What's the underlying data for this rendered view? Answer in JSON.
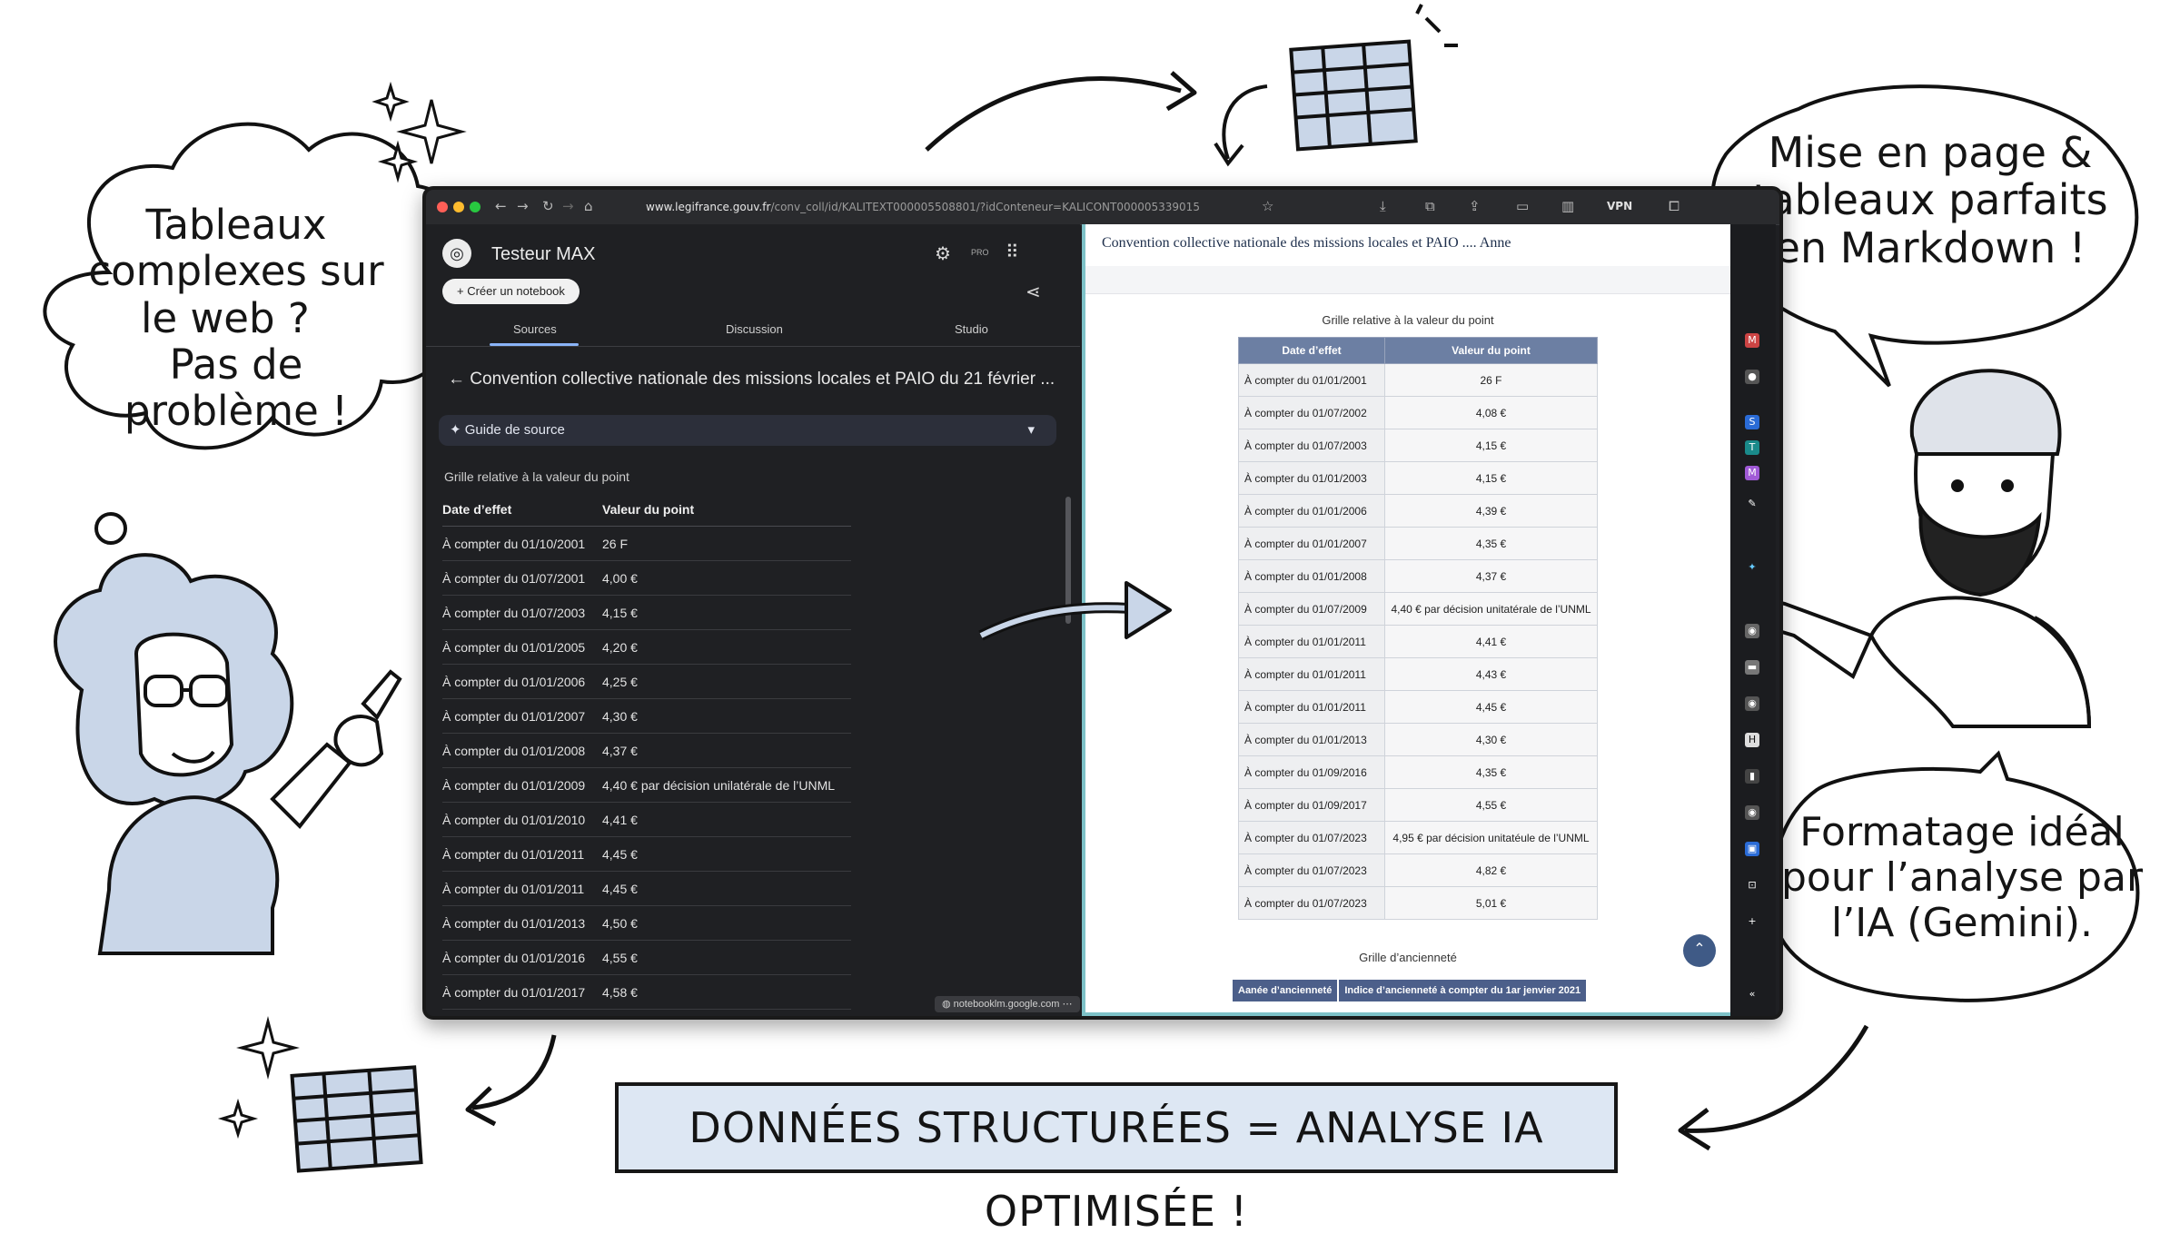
{
  "bubbles": {
    "left_lines": [
      "Tableaux",
      "complexes sur",
      "le web ?",
      "Pas de",
      "problème !"
    ],
    "top_right_lines": [
      "Mise en page &",
      "tableaux parfaits",
      "en Markdown !"
    ],
    "bottom_right_lines": [
      "Formatage idéal",
      "pour l’analyse par",
      "l’IA (Gemini)."
    ]
  },
  "banner_text": "DONNÉES STRUCTURÉES = ANALYSE IA OPTIMISÉE !",
  "browser": {
    "url_domain": "www.legifrance.gouv.fr",
    "url_rest": "/conv_coll/id/KALITEXT000005508801/?idConteneur=KALICONT000005339015",
    "vpn_label": "VPN"
  },
  "notebook": {
    "title": "Testeur MAX",
    "create_button": "Créer un notebook",
    "pro_label": "PRO",
    "tabs": [
      "Sources",
      "Discussion",
      "Studio"
    ],
    "source_title": "Convention collective nationale des missions locales et PAIO du 21 février ...",
    "source_guide": "Guide de source",
    "table_caption": "Grille relative à la valeur du point",
    "table_headers": [
      "Date d’effet",
      "Valeur du point"
    ],
    "rows": [
      [
        "À compter du 01/10/2001",
        "26 F"
      ],
      [
        "À compter du 01/07/2001",
        "4,00 €"
      ],
      [
        "À compter du 01/07/2003",
        "4,15 €"
      ],
      [
        "À compter du 01/01/2005",
        "4,20 €"
      ],
      [
        "À compter du 01/01/2006",
        "4,25 €"
      ],
      [
        "À compter du 01/01/2007",
        "4,30 €"
      ],
      [
        "À compter du 01/01/2008",
        "4,37 €"
      ],
      [
        "À compter du 01/01/2009",
        "4,40 € par décision unilatérale de l’UNML"
      ],
      [
        "À compter du 01/01/2010",
        "4,41 €"
      ],
      [
        "À compter du 01/01/2011",
        "4,45 €"
      ],
      [
        "À compter du 01/01/2011",
        "4,45 €"
      ],
      [
        "À compter du 01/01/2013",
        "4,50 €"
      ],
      [
        "À compter du 01/01/2016",
        "4,55 €"
      ],
      [
        "À compter du 01/01/2017",
        "4,58 €"
      ]
    ],
    "status_url": "notebooklm.google.com"
  },
  "document": {
    "header": "Convention collective nationale des missions locales et PAIO .... Anne",
    "table_caption": "Grille relative à la valeur du point",
    "table_headers": [
      "Date d’effet",
      "Valeur du point"
    ],
    "rows": [
      [
        "À compter du 01/01/2001",
        "26 F"
      ],
      [
        "À compter du 01/07/2002",
        "4,08 €"
      ],
      [
        "À compter du 01/07/2003",
        "4,15 €"
      ],
      [
        "À compter du 01/01/2003",
        "4,15 €"
      ],
      [
        "À compter du 01/01/2006",
        "4,39 €"
      ],
      [
        "À compter du 01/01/2007",
        "4,35 €"
      ],
      [
        "À compter du 01/01/2008",
        "4,37 €"
      ],
      [
        "À compter du 01/07/2009",
        "4,40 € par décision unitatérale de l’UNML"
      ],
      [
        "À compter du 01/01/2011",
        "4,41 €"
      ],
      [
        "À compter du 01/01/2011",
        "4,43 €"
      ],
      [
        "À compter du 01/01/2011",
        "4,45 €"
      ],
      [
        "À compter du 01/01/2013",
        "4,30 €"
      ],
      [
        "À compter du 01/09/2016",
        "4,35 €"
      ],
      [
        "À compter du 01/09/2017",
        "4,55 €"
      ],
      [
        "À compter du 01/07/2023",
        "4,95 € par décision unitatéule de l’UNML"
      ],
      [
        "À compter du 01/07/2023",
        "4,82 €"
      ],
      [
        "À compter du 01/07/2023",
        "5,01 €"
      ]
    ],
    "caption2": "Grille d’ancienneté",
    "table2_headers": [
      "Aanée d’ancienneté",
      "Indice d’ancienneté à compter du 1ar jenvier 2021"
    ]
  },
  "colors": {
    "accent_blue": "#8ab4f8",
    "table_header": "#6c7fa3",
    "banner_bg": "#dde7f3",
    "panel_border": "#7ec2c8"
  }
}
